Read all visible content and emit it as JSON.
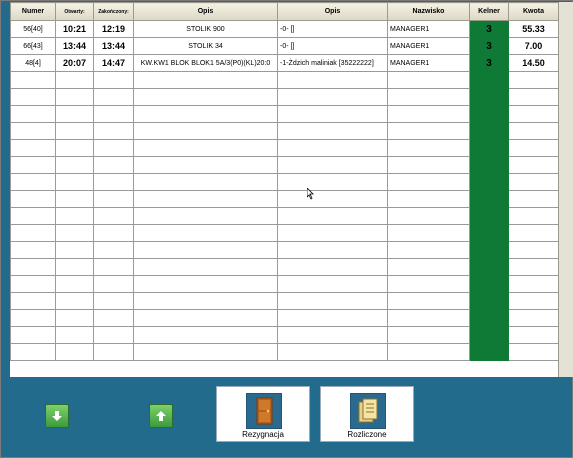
{
  "table": {
    "headers": [
      "Numer",
      "Otwarty:",
      "Zakończony:",
      "Opis",
      "Opis",
      "Nazwisko",
      "Kelner",
      "Kwota"
    ],
    "rows": [
      {
        "numer": "56[40]",
        "otwarty": "10:21",
        "zakonczony": "12:19",
        "opis1": "STOLIK 900",
        "opis2": "-0- []",
        "nazwisko": "MANAGER1",
        "kelner": "3",
        "kwota": "55.33"
      },
      {
        "numer": "66[43]",
        "otwarty": "13:44",
        "zakonczony": "13:44",
        "opis1": "STOLIK 34",
        "opis2": "-0- []",
        "nazwisko": "MANAGER1",
        "kelner": "3",
        "kwota": "7.00"
      },
      {
        "numer": "48[4]",
        "otwarty": "20:07",
        "zakonczony": "14:47",
        "opis1": "KW.KW1 BLOK BLOK1 5A/3(P0)(KL)20:0",
        "opis2": "-1-Żdzich maliniak [35222222]",
        "nazwisko": "MANAGER1",
        "kelner": "3",
        "kwota": "14.50"
      }
    ],
    "empty_row_count": 17
  },
  "buttons": {
    "down_icon": "arrow-down-icon",
    "up_icon": "arrow-up-icon",
    "rezygnacja": {
      "label": "Rezygnacja",
      "icon": "door-icon"
    },
    "rozliczone": {
      "label": "Rozliczone",
      "icon": "documents-icon"
    }
  },
  "colors": {
    "background": "#236b8c",
    "kelner": "#0f7a35",
    "arrow_button": "#4caf3c"
  }
}
